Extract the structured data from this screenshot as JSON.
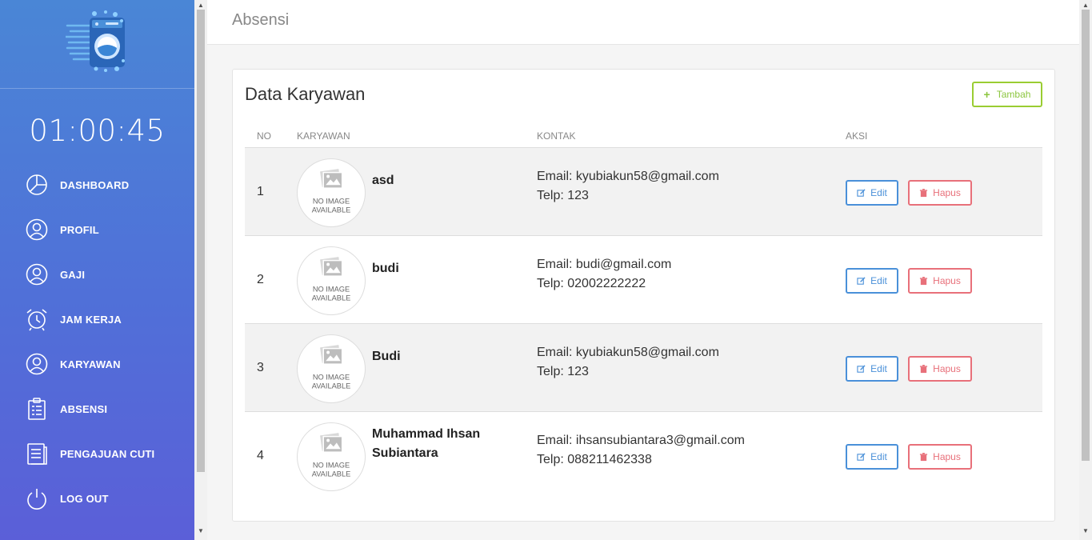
{
  "sidebar": {
    "clock": "01:00:45",
    "items": [
      {
        "label": "DASHBOARD",
        "icon": "pie-chart-icon"
      },
      {
        "label": "PROFIL",
        "icon": "user-circle-icon"
      },
      {
        "label": "GAJI",
        "icon": "user-circle-icon"
      },
      {
        "label": "JAM KERJA",
        "icon": "alarm-clock-icon"
      },
      {
        "label": "KARYAWAN",
        "icon": "user-circle-icon"
      },
      {
        "label": "ABSENSI",
        "icon": "clipboard-icon"
      },
      {
        "label": "PENGAJUAN CUTI",
        "icon": "document-icon"
      },
      {
        "label": "LOG OUT",
        "icon": "power-icon"
      }
    ]
  },
  "header": {
    "title": "Absensi"
  },
  "card": {
    "title": "Data Karyawan",
    "add_button": "Tambah"
  },
  "table": {
    "columns": [
      "NO",
      "KARYAWAN",
      "KONTAK",
      "AKSI"
    ],
    "rows": [
      {
        "no": "1",
        "name": "asd",
        "email": "Email: kyubiakun58@gmail.com",
        "phone": "Telp: 123",
        "edit": "Edit",
        "delete": "Hapus"
      },
      {
        "no": "2",
        "name": "budi",
        "email": "Email: budi@gmail.com",
        "phone": "Telp: 02002222222",
        "edit": "Edit",
        "delete": "Hapus"
      },
      {
        "no": "3",
        "name": "Budi",
        "email": "Email: kyubiakun58@gmail.com",
        "phone": "Telp: 123",
        "edit": "Edit",
        "delete": "Hapus"
      },
      {
        "no": "4",
        "name": "Muhammad Ihsan Subiantara",
        "email": "Email: ihsansubiantara3@gmail.com",
        "phone": "Telp: 088211462338",
        "edit": "Edit",
        "delete": "Hapus"
      }
    ],
    "avatar_placeholder": {
      "line1": "NO IMAGE",
      "line2": "AVAILABLE"
    }
  },
  "colors": {
    "sidebar_top": "#4a86d6",
    "sidebar_bottom": "#5b5fd8",
    "add_button": "#8cc63f",
    "edit_button": "#4a90d9",
    "delete_button": "#e8707a"
  }
}
